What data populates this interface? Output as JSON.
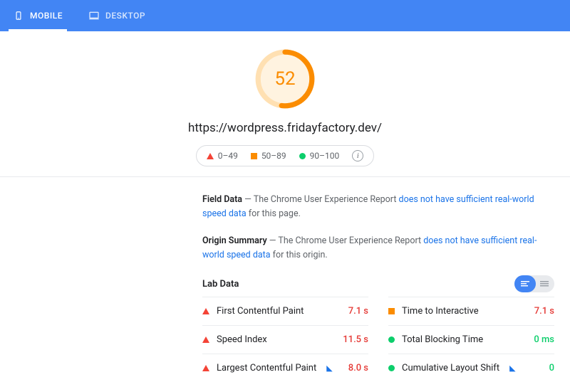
{
  "tabs": {
    "mobile": "MOBILE",
    "desktop": "DESKTOP"
  },
  "score": "52",
  "url": "https://wordpress.fridayfactory.dev/",
  "legend": {
    "poor": "0–49",
    "mid": "50–89",
    "good": "90–100"
  },
  "field_data": {
    "label": "Field Data",
    "prefix": "  —  The Chrome User Experience Report ",
    "link": "does not have sufficient real-world speed data",
    "suffix": " for this page."
  },
  "origin_summary": {
    "label": "Origin Summary",
    "prefix": "  —  The Chrome User Experience Report ",
    "link": "does not have sufficient real-world speed data",
    "suffix": " for this origin."
  },
  "lab_data_label": "Lab Data",
  "metrics": {
    "fcp": {
      "name": "First Contentful Paint",
      "value": "7.1 s"
    },
    "tti": {
      "name": "Time to Interactive",
      "value": "7.1 s"
    },
    "si": {
      "name": "Speed Index",
      "value": "11.5 s"
    },
    "tbt": {
      "name": "Total Blocking Time",
      "value": "0 ms"
    },
    "lcp": {
      "name": "Largest Contentful Paint",
      "value": "8.0 s"
    },
    "cls": {
      "name": "Cumulative Layout Shift",
      "value": "0"
    }
  }
}
